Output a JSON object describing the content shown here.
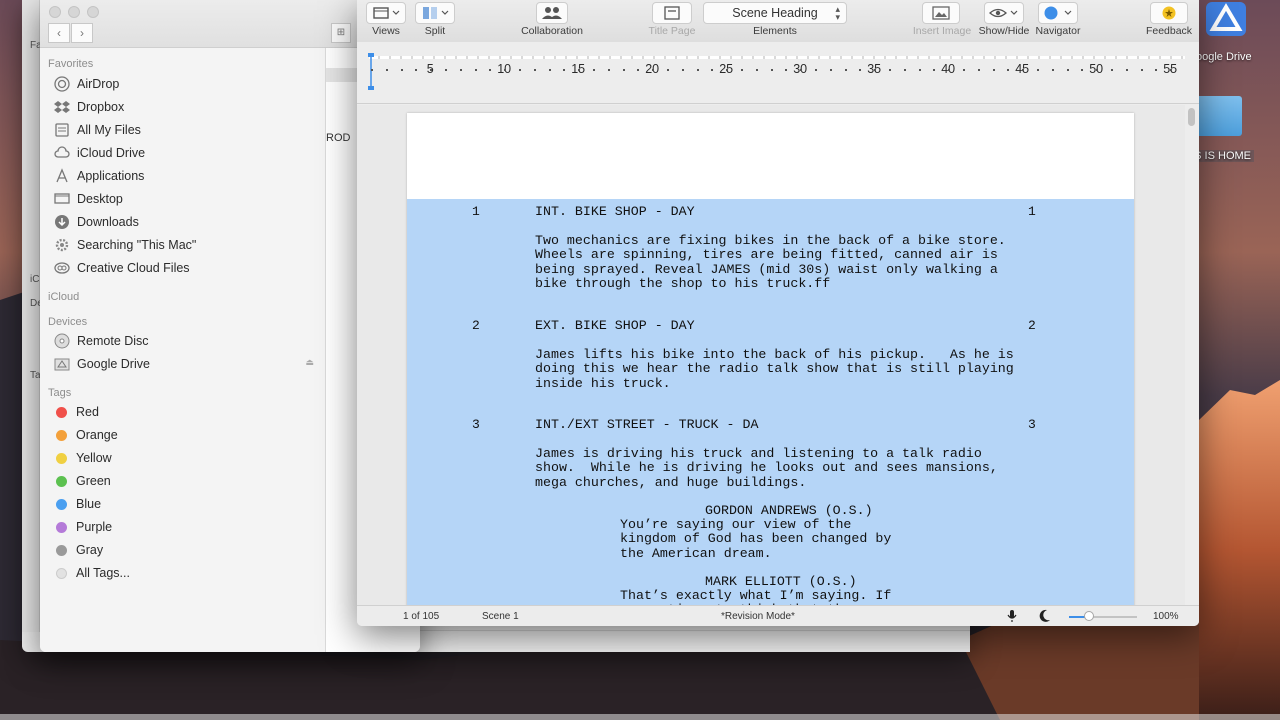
{
  "desktop": {
    "drive_label": "oogle Drive",
    "folder_label": "S IS HOME"
  },
  "back_window": {
    "letters": [
      "Fa",
      "iC",
      "De",
      "Ta"
    ]
  },
  "finder": {
    "sections": {
      "favorites": "Favorites",
      "icloud": "iCloud",
      "devices": "Devices",
      "tags": "Tags"
    },
    "favorites": [
      {
        "label": "AirDrop",
        "icon": "airdrop-icon"
      },
      {
        "label": "Dropbox",
        "icon": "dropbox-icon"
      },
      {
        "label": "All My Files",
        "icon": "all-files-icon"
      },
      {
        "label": "iCloud Drive",
        "icon": "cloud-icon"
      },
      {
        "label": "Applications",
        "icon": "applications-icon"
      },
      {
        "label": "Desktop",
        "icon": "desktop-icon"
      },
      {
        "label": "Downloads",
        "icon": "downloads-icon"
      },
      {
        "label": "Searching \"This Mac\"",
        "icon": "gear-icon"
      },
      {
        "label": "Creative Cloud Files",
        "icon": "creative-cloud-icon"
      }
    ],
    "devices": [
      {
        "label": "Remote Disc",
        "icon": "disc-icon"
      },
      {
        "label": "Google Drive",
        "icon": "drive-icon"
      }
    ],
    "tags": [
      {
        "label": "Red",
        "color": "#f0504a"
      },
      {
        "label": "Orange",
        "color": "#f3a03a"
      },
      {
        "label": "Yellow",
        "color": "#f0d042"
      },
      {
        "label": "Green",
        "color": "#5cc150"
      },
      {
        "label": "Blue",
        "color": "#4a9ff0"
      },
      {
        "label": "Purple",
        "color": "#b47ad8"
      },
      {
        "label": "Gray",
        "color": "#9a9a9a"
      },
      {
        "label": "All Tags...",
        "color": "#e2e2e2"
      }
    ],
    "content_partial": "ROD"
  },
  "writer": {
    "toolbar": {
      "views": "Views",
      "split": "Split",
      "collaboration": "Collaboration",
      "title_page": "Title Page",
      "elements": "Elements",
      "element_value": "Scene Heading",
      "insert_image": "Insert Image",
      "show_hide": "Show/Hide",
      "navigator": "Navigator",
      "feedback": "Feedback"
    },
    "ruler_numbers": [
      "5",
      "10",
      "15",
      "20",
      "25",
      "30",
      "35",
      "40",
      "45",
      "50",
      "55"
    ],
    "scenes": [
      {
        "num": "1",
        "heading": "INT. BIKE SHOP - DAY",
        "action": "Two mechanics are fixing bikes in the back of a bike store.\nWheels are spinning, tires are being fitted, canned air is\nbeing sprayed. Reveal JAMES (mid 30s) waist only walking a\nbike through the shop to his truck.ff"
      },
      {
        "num": "2",
        "heading": "EXT. BIKE SHOP - DAY",
        "action": "James lifts his bike into the back of his pickup.   As he is\ndoing this we hear the radio talk show that is still playing\ninside his truck."
      },
      {
        "num": "3",
        "heading": "INT./EXT STREET - TRUCK - DA",
        "action": "James is driving his truck and listening to a talk radio\nshow.  While he is driving he looks out and sees mansions,\nmega churches, and huge buildings."
      }
    ],
    "dialogue": [
      {
        "character": "GORDON ANDREWS (O.S.)",
        "line": "You’re saying our view of the\nkingdom of God has been changed by\nthe American dream."
      },
      {
        "character": "MARK ELLIOTT (O.S.)",
        "line": "That’s exactly what I’m saying. If\nwe continue to think that the"
      }
    ],
    "status": {
      "page": "1 of 105",
      "scene": "Scene 1",
      "mode": "*Revision Mode*",
      "zoom": "100%",
      "zoom_level": 0.3
    }
  }
}
